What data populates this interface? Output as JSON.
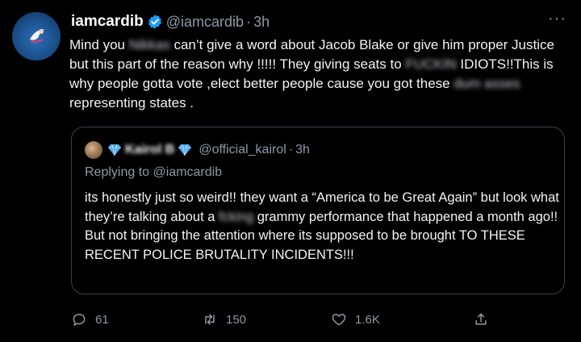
{
  "tweet": {
    "display_name": "iamcardib",
    "handle": "@iamcardib",
    "separator": "·",
    "time": "3h",
    "more": "···",
    "body": [
      {
        "text": "Mind you ",
        "blur": false
      },
      {
        "text": "Nikkas",
        "blur": true
      },
      {
        "text": " can’t give a word about Jacob Blake or give him proper Justice but this part of the reason why !!!!! They giving seats to ",
        "blur": false
      },
      {
        "text": "FUCKIN",
        "blur": true
      },
      {
        "text": " IDIOTS!!This is why people gotta vote ,elect better people cause you got these ",
        "blur": false
      },
      {
        "text": "dum asses",
        "blur": true
      },
      {
        "text": " representing states .",
        "blur": false
      }
    ]
  },
  "quote": {
    "display_name": "Kairol B",
    "handle": "@official_kairol",
    "separator": "·",
    "time": "3h",
    "replying": "Replying to @iamcardib",
    "body": [
      {
        "text": "its honestly just so weird!! they want a “America to be Great Again” but look what they’re talking about a ",
        "blur": false
      },
      {
        "text": "fcking",
        "blur": true
      },
      {
        "text": " grammy performance that happened a month ago!! But not bringing the attention where its supposed to be brought TO THESE RECENT POLICE BRUTALITY INCIDENTS!!!",
        "blur": false
      }
    ]
  },
  "actions": {
    "reply_count": "61",
    "retweet_count": "150",
    "like_count": "1.6K"
  },
  "colors": {
    "background": "#000000",
    "text": "#f1f3f4",
    "muted": "#8b98a5",
    "verified": "#1d9bf0",
    "diamond": "#4fa8e8"
  },
  "icons": {
    "verified": "verified-badge-icon",
    "reply": "reply-icon",
    "retweet": "retweet-icon",
    "like": "heart-icon",
    "share": "share-icon",
    "more": "more-icon",
    "diamond": "diamond-emoji-icon"
  }
}
